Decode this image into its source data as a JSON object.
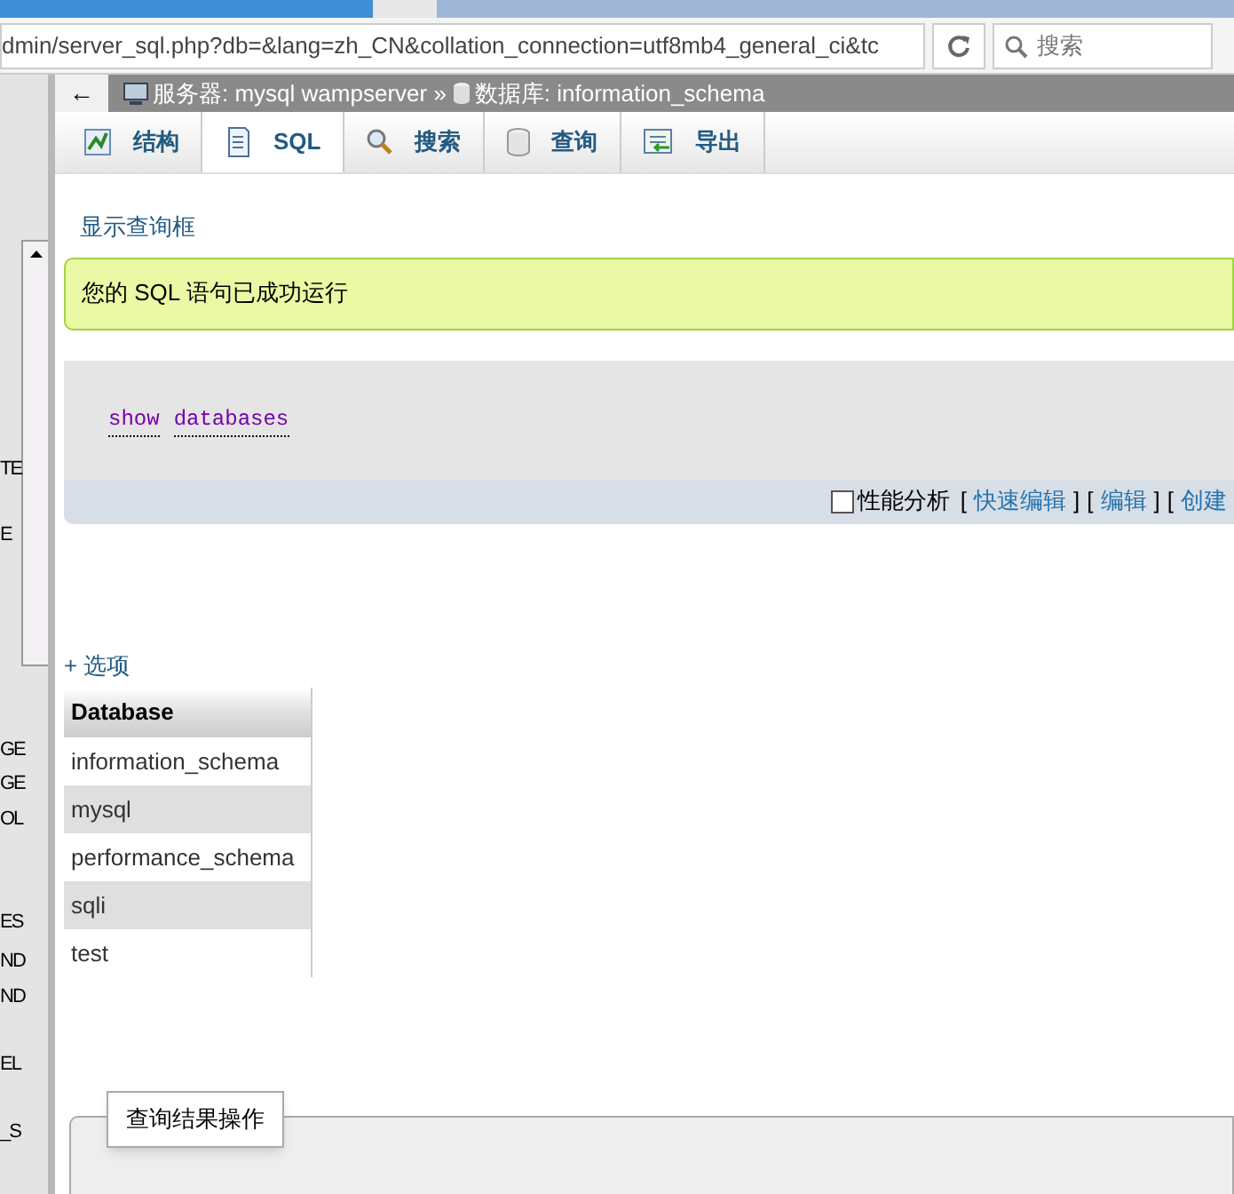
{
  "address_bar": {
    "url": "dmin/server_sql.php?db=&lang=zh_CN&collation_connection=utf8mb4_general_ci&tc",
    "search_placeholder": "搜索"
  },
  "sidebar": {
    "fragments": [
      "TE",
      "E",
      "GE",
      "GE",
      "OL",
      "ES",
      "ND",
      "ND",
      "EL",
      "_S"
    ]
  },
  "breadcrumb": {
    "back": "←",
    "server": "服务器: mysql wampserver »",
    "database": "数据库: information_schema"
  },
  "tabs": [
    {
      "label": "结构",
      "kind": "structure",
      "selected": false
    },
    {
      "label": "SQL",
      "kind": "sql",
      "selected": true
    },
    {
      "label": "搜索",
      "kind": "search",
      "selected": false
    },
    {
      "label": "查询",
      "kind": "query",
      "selected": false
    },
    {
      "label": "导出",
      "kind": "export",
      "selected": false
    }
  ],
  "show_query_link": "显示查询框",
  "success_message": "您的 SQL 语句已成功运行",
  "sql": {
    "keywords": [
      "show",
      "databases"
    ]
  },
  "query_options": {
    "profiling_label": "性能分析",
    "profiling_checked": false,
    "links": [
      {
        "open": "[",
        "text": "快速编辑",
        "close": "]"
      },
      {
        "open": "[",
        "text": "编辑",
        "close": "]"
      },
      {
        "open": "[",
        "text": "创建"
      }
    ]
  },
  "options_link": "+ 选项",
  "table": {
    "columns": [
      "Database"
    ],
    "rows": [
      "information_schema",
      "mysql",
      "performance_schema",
      "sqli",
      "test"
    ]
  },
  "result_ops": {
    "legend": "查询结果操作"
  }
}
